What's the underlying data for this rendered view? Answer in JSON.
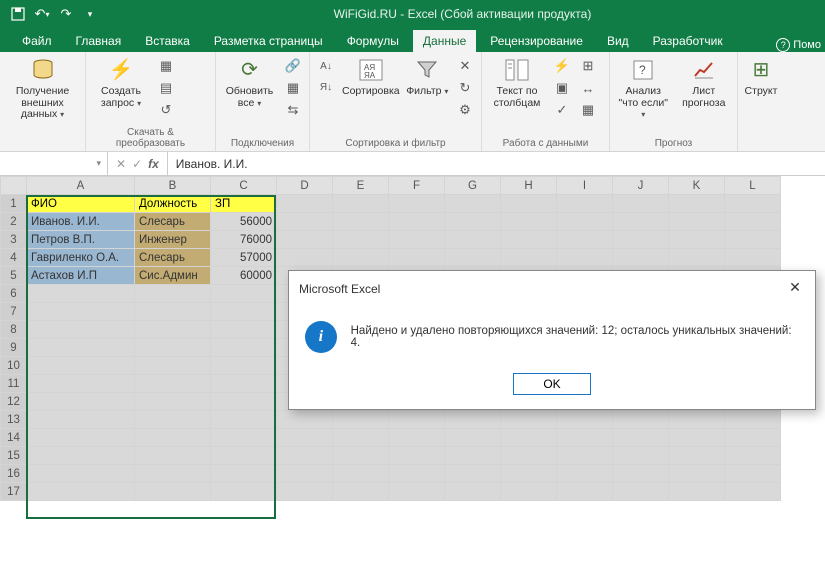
{
  "app_title": "WiFiGid.RU - Excel (Сбой активации продукта)",
  "tabs": {
    "file": "Файл",
    "home": "Главная",
    "insert": "Вставка",
    "layout": "Разметка страницы",
    "formulas": "Формулы",
    "data": "Данные",
    "review": "Рецензирование",
    "view": "Вид",
    "developer": "Разработчик",
    "help_prefix": "Помо"
  },
  "ribbon": {
    "get_external": {
      "label": "Получение внешних данных",
      "dd": "▾"
    },
    "query": {
      "btn": "Создать запрос",
      "dd": "▾",
      "group": "Скачать & преобразовать"
    },
    "connections": {
      "btn": "Обновить все",
      "dd": "▾",
      "group": "Подключения"
    },
    "sortfilter": {
      "sort_btn": "Сортировка",
      "filter_btn": "Фильтр",
      "group": "Сортировка и фильтр"
    },
    "datatools": {
      "btn": "Текст по столбцам",
      "group": "Работа с данными"
    },
    "forecast": {
      "whatif": "Анализ \"что если\"",
      "sheet": "Лист прогноза",
      "group": "Прогноз"
    },
    "outline": {
      "btn": "Структ"
    }
  },
  "namebox_value": "",
  "formula_value": "Иванов. И.И.",
  "columns": [
    "A",
    "B",
    "C",
    "D",
    "E",
    "F",
    "G",
    "H",
    "I",
    "J",
    "K",
    "L"
  ],
  "headers": {
    "a": "ФИО",
    "b": "Должность",
    "c": "ЗП"
  },
  "rows": [
    {
      "a": "Иванов. И.И.",
      "b": "Слесарь",
      "c": "56000"
    },
    {
      "a": "Петров В.П.",
      "b": "Инженер",
      "c": "76000"
    },
    {
      "a": "Гавриленко О.А.",
      "b": "Слесарь",
      "c": "57000"
    },
    {
      "a": "Астахов И.П",
      "b": "Сис.Админ",
      "c": "60000"
    }
  ],
  "dialog": {
    "title": "Microsoft Excel",
    "message": "Найдено и удалено повторяющихся значений: 12; осталось уникальных значений: 4.",
    "ok": "OK"
  }
}
